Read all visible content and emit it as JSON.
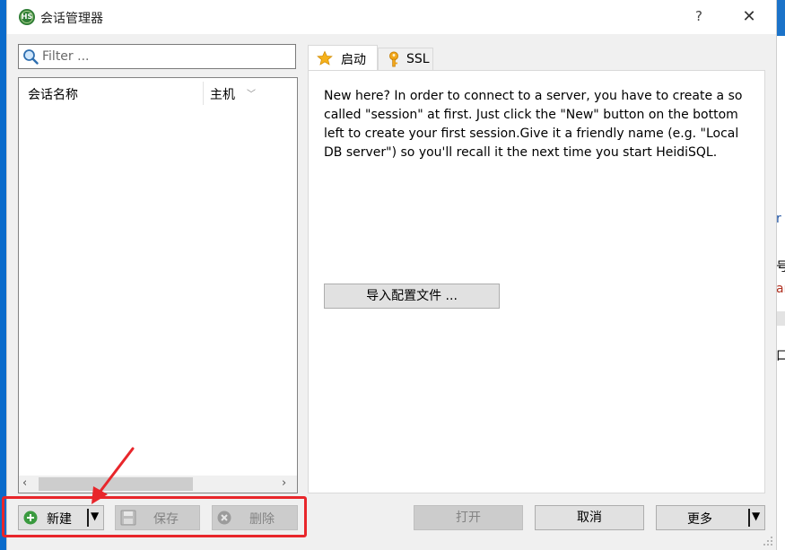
{
  "window": {
    "title": "会话管理器",
    "app_icon": "heidisql-icon",
    "app_icon_text": "HS",
    "help_label": "?",
    "close_label": "✕"
  },
  "filter": {
    "placeholder": "Filter ..."
  },
  "session_list": {
    "columns": [
      "会话名称",
      "主机"
    ],
    "sort_indicator": "chevron-down",
    "rows": []
  },
  "tabs": [
    {
      "label": "启动",
      "icon": "star-icon",
      "active": true
    },
    {
      "label": "SSL",
      "icon": "key-icon",
      "active": false
    }
  ],
  "start_tab": {
    "intro": "New here? In order to connect to a server, you have to create a so called \"session\" at first. Just click the \"New\" button on the bottom left to create your first session.Give it a friendly name (e.g. \"Local DB server\") so you'll recall it the next time you start HeidiSQL.",
    "import_button": "导入配置文件 ..."
  },
  "buttons": {
    "new": "新建",
    "save": "保存",
    "delete": "删除",
    "open": "打开",
    "cancel": "取消",
    "more": "更多"
  },
  "background_app": {
    "fragments": [
      "r",
      "号",
      "an",
      "口"
    ]
  },
  "colors": {
    "annotation_red": "#e8262b",
    "dialog_bg": "#f0f0f0",
    "disabled_button_bg": "#cccccc",
    "accent_blue": "#0b6bcb"
  }
}
